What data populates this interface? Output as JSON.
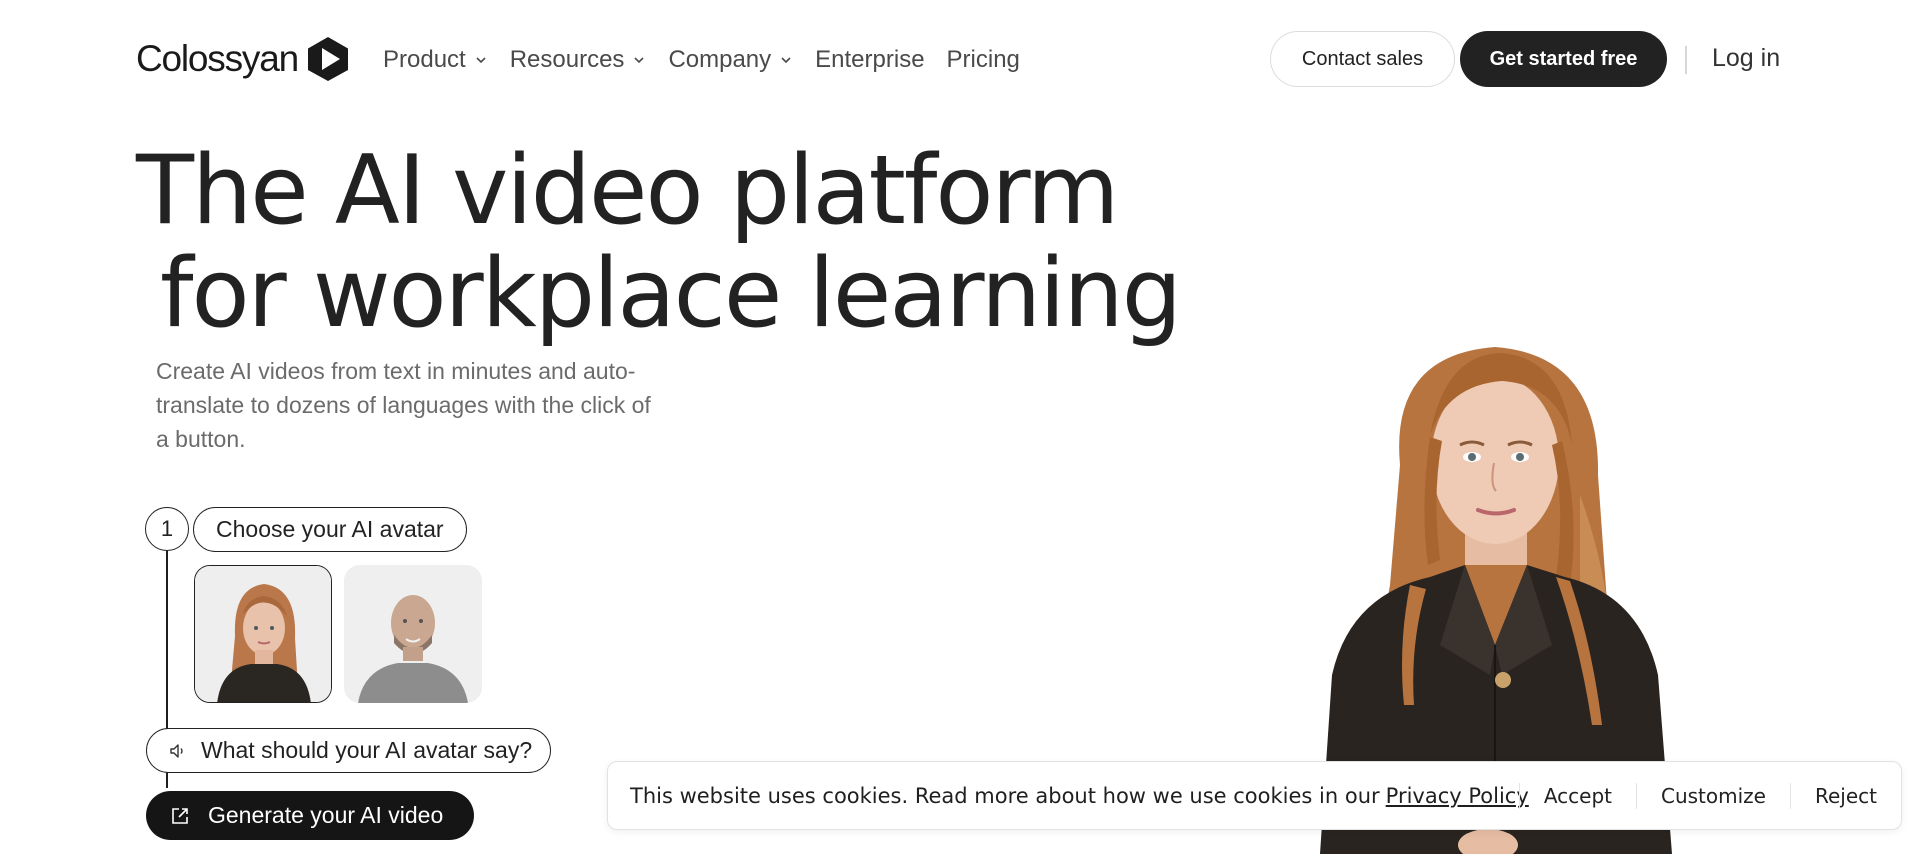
{
  "header": {
    "logo_text": "Colossyan",
    "nav": [
      {
        "label": "Product",
        "has_dropdown": true
      },
      {
        "label": "Resources",
        "has_dropdown": true
      },
      {
        "label": "Company",
        "has_dropdown": true
      },
      {
        "label": "Enterprise",
        "has_dropdown": false
      },
      {
        "label": "Pricing",
        "has_dropdown": false
      }
    ],
    "contact_sales": "Contact sales",
    "get_started": "Get started free",
    "login": "Log in"
  },
  "hero": {
    "title_line1": "The AI video platform",
    "title_line2": "for workplace learning",
    "subtitle": "Create AI videos from text in minutes and auto-translate to dozens of languages with the click of a button."
  },
  "steps": {
    "step_number": "1",
    "choose_label": "Choose your AI avatar",
    "say_placeholder": "What should your AI avatar say?",
    "generate_label": "Generate your AI video"
  },
  "cookie": {
    "text": "This website uses cookies. Read more about how we use cookies in our",
    "link": "Privacy Policy",
    "accept": "Accept",
    "customize": "Customize",
    "reject": "Reject"
  },
  "icons": {
    "logo": "play-hexagon-icon",
    "chevron": "chevron-down-icon",
    "speaker": "speaker-icon",
    "generate": "external-link-icon"
  },
  "colors": {
    "primary_dark": "#222222",
    "text_muted": "#6b6b6b",
    "border_light": "#dcdcdc"
  }
}
